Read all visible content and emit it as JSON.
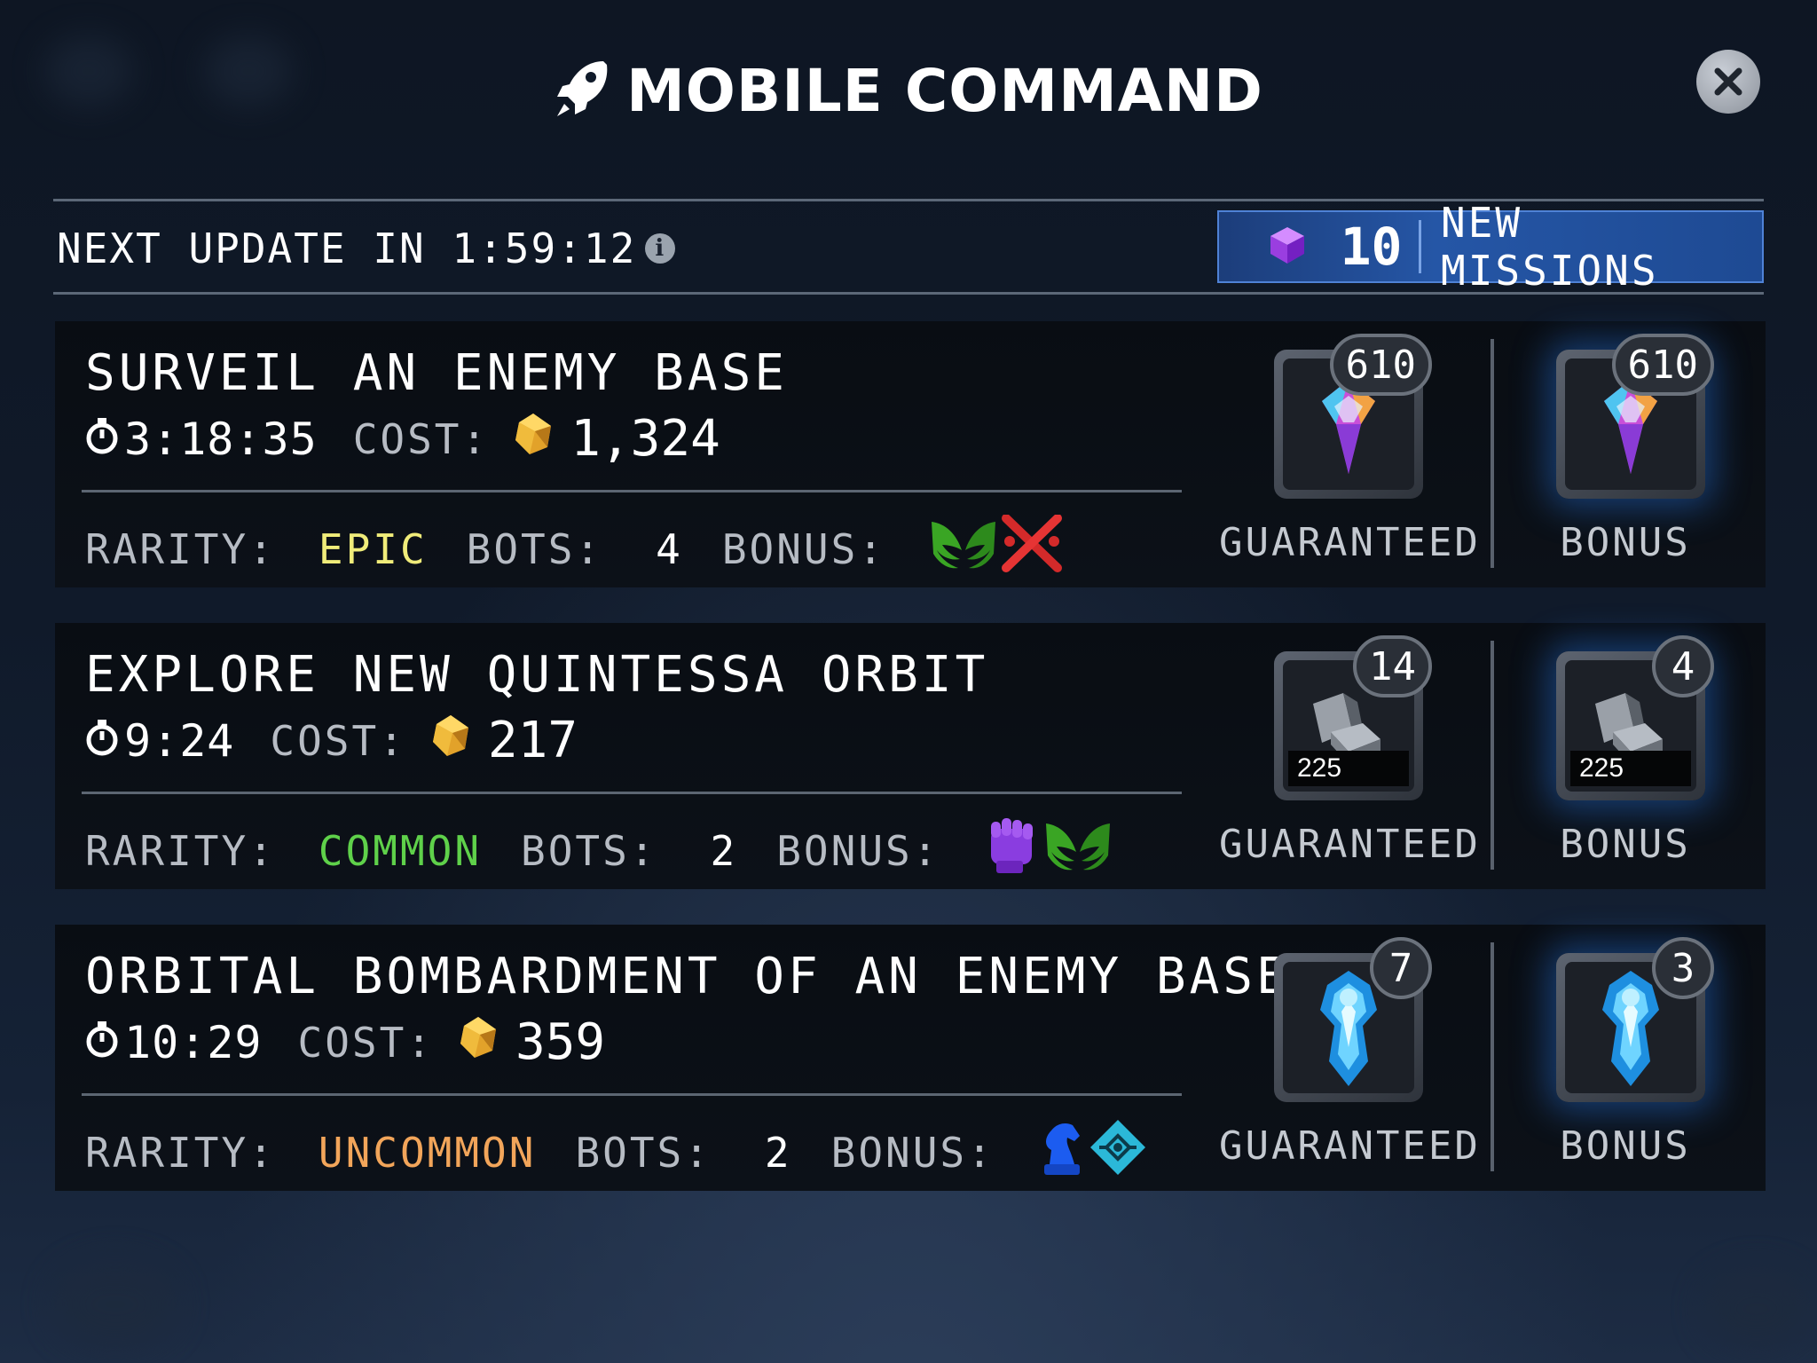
{
  "header": {
    "title": "MOBILE COMMAND",
    "icon": "rocket-icon"
  },
  "update": {
    "label": "NEXT UPDATE IN 1:59:12"
  },
  "new_missions": {
    "count": "10",
    "label": "NEW MISSIONS"
  },
  "missions": [
    {
      "title": "SURVEIL AN ENEMY BASE",
      "time": "3:18:35",
      "cost_label": "COST:",
      "cost": "1,324",
      "rarity_label": "RARITY:",
      "rarity": "EPIC",
      "rarity_color": "#f0ec7a",
      "bots_label": "BOTS:",
      "bots": "4",
      "bonus_label": "BONUS:",
      "bonus_icons": [
        "green-wings-icon",
        "red-crossed-swords-icon"
      ],
      "guaranteed": {
        "count": "610",
        "item": "energon-shard-icon",
        "label": "GUARANTEED"
      },
      "bonus": {
        "count": "610",
        "item": "energon-shard-icon",
        "label": "BONUS"
      }
    },
    {
      "title": "EXPLORE NEW QUINTESSA ORBIT",
      "time": "9:24",
      "cost_label": "COST:",
      "cost": "217",
      "rarity_label": "RARITY:",
      "rarity": "COMMON",
      "rarity_color": "#5fd14a",
      "bots_label": "BOTS:",
      "bots": "2",
      "bonus_label": "BONUS:",
      "bonus_icons": [
        "purple-fist-icon",
        "green-wings-icon"
      ],
      "guaranteed": {
        "count": "14",
        "item": "metal-alloy-icon",
        "amount": "225",
        "label": "GUARANTEED"
      },
      "bonus": {
        "count": "4",
        "item": "metal-alloy-icon",
        "amount": "225",
        "label": "BONUS"
      }
    },
    {
      "title": "ORBITAL BOMBARDMENT OF AN ENEMY BASE",
      "time": "10:29",
      "cost_label": "COST:",
      "cost": "359",
      "rarity_label": "RARITY:",
      "rarity": "UNCOMMON",
      "rarity_color": "#f2a55a",
      "bots_label": "BOTS:",
      "bots": "2",
      "bonus_label": "BONUS:",
      "bonus_icons": [
        "blue-knight-icon",
        "cyan-circuit-icon"
      ],
      "guaranteed": {
        "count": "7",
        "item": "blue-armor-part-icon",
        "label": "GUARANTEED"
      },
      "bonus": {
        "count": "3",
        "item": "blue-armor-part-icon",
        "label": "BONUS"
      }
    }
  ]
}
